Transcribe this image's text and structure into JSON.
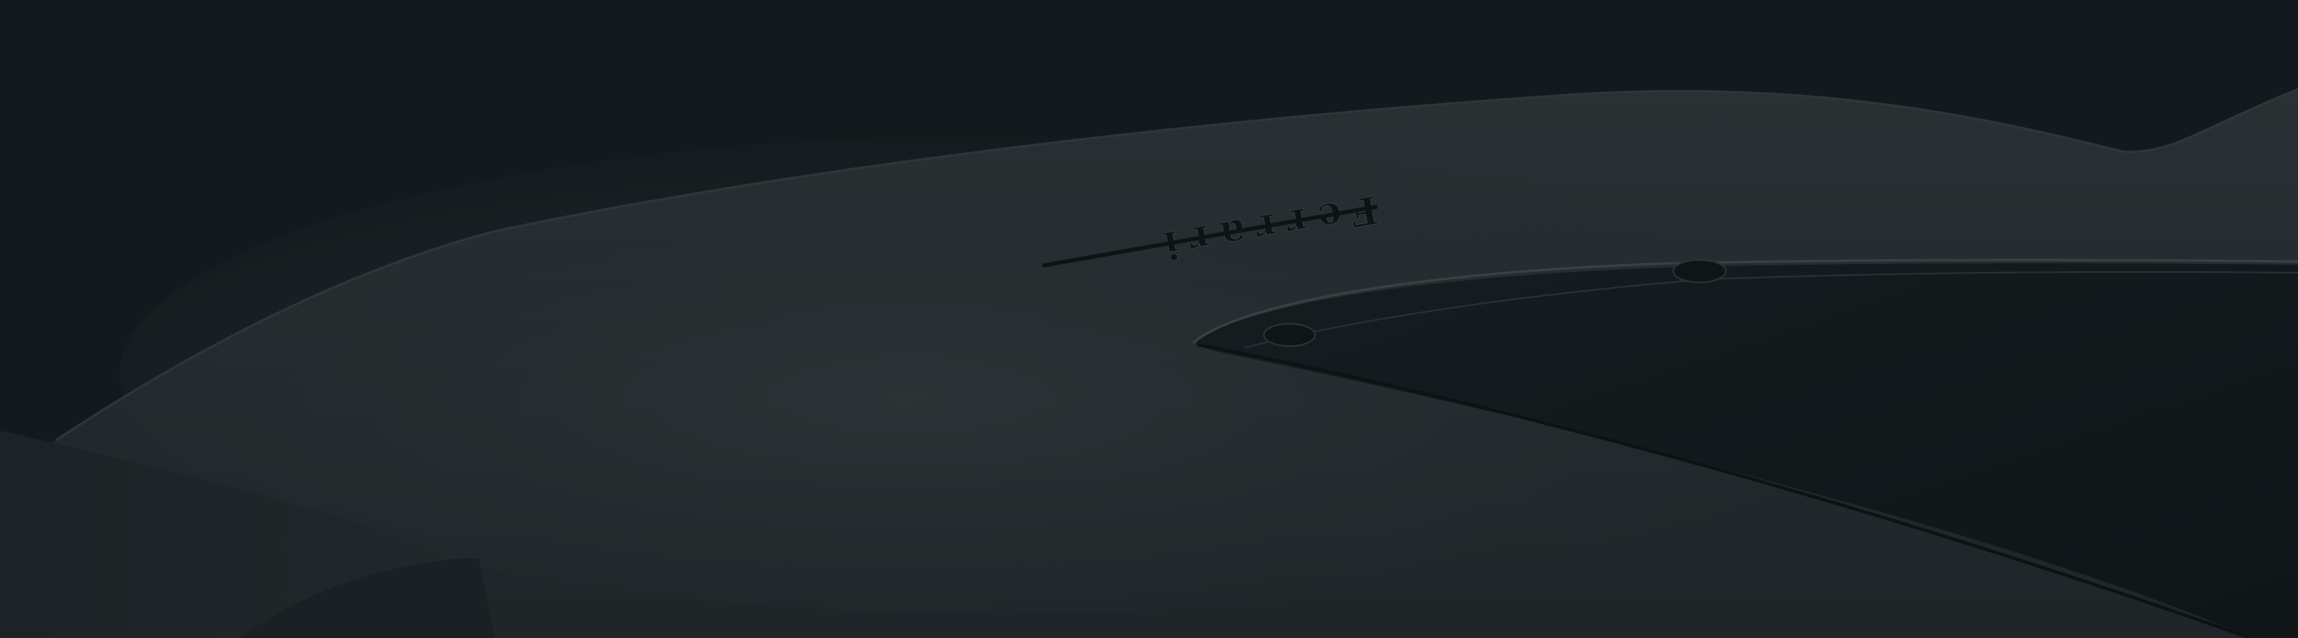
{
  "hero": {
    "description_hidden": "",
    "emblem_word": "Ferrari",
    "colors": {
      "backdrop": "#131a1d",
      "body_panel": "#23292c",
      "body_highlight": "#2c3235",
      "opening": "#13191c",
      "trim_line": "#3a4043",
      "shadow": "#0d1214"
    },
    "icons": {
      "emblem": "mirrored-script-emblem-icon",
      "fastener_top": "round-fastener-icon",
      "fastener_left": "round-fastener-icon"
    }
  }
}
